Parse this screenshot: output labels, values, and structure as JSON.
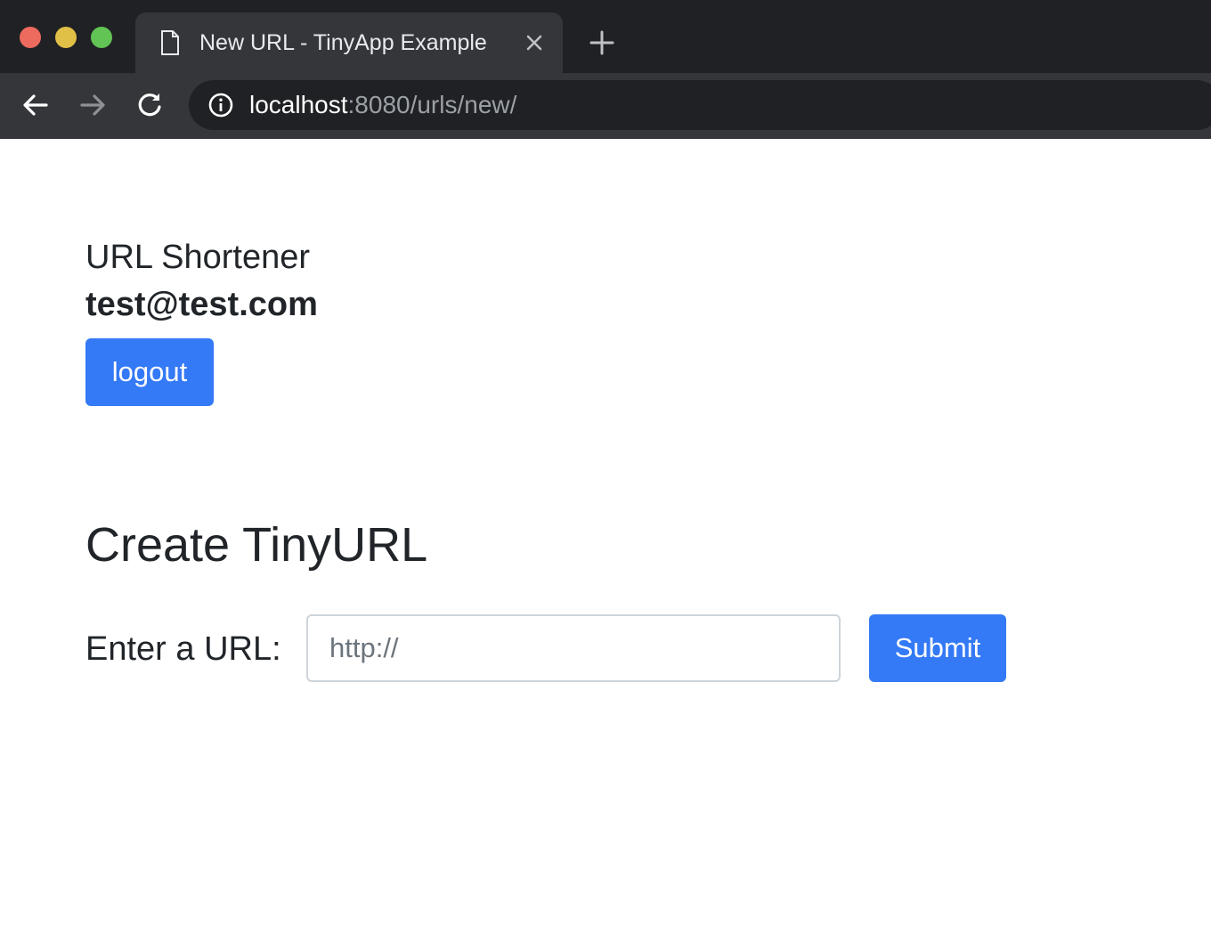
{
  "browser": {
    "tab_title": "New URL - TinyApp Example",
    "url_host": "localhost",
    "url_rest": ":8080/urls/new/",
    "icons": [
      "page-icon",
      "close-icon",
      "plus-icon",
      "back-arrow-icon",
      "forward-arrow-icon",
      "reload-icon",
      "info-icon"
    ]
  },
  "header": {
    "brand": "URL Shortener",
    "user_email": "test@test.com",
    "logout_label": "logout"
  },
  "main": {
    "title": "Create TinyURL",
    "form": {
      "label": "Enter a URL:",
      "input_value": "",
      "input_placeholder": "http://",
      "submit_label": "Submit"
    }
  },
  "colors": {
    "primary": "#3479f6",
    "tabstrip": "#202124",
    "toolbar": "#35363a",
    "text": "#212529"
  }
}
